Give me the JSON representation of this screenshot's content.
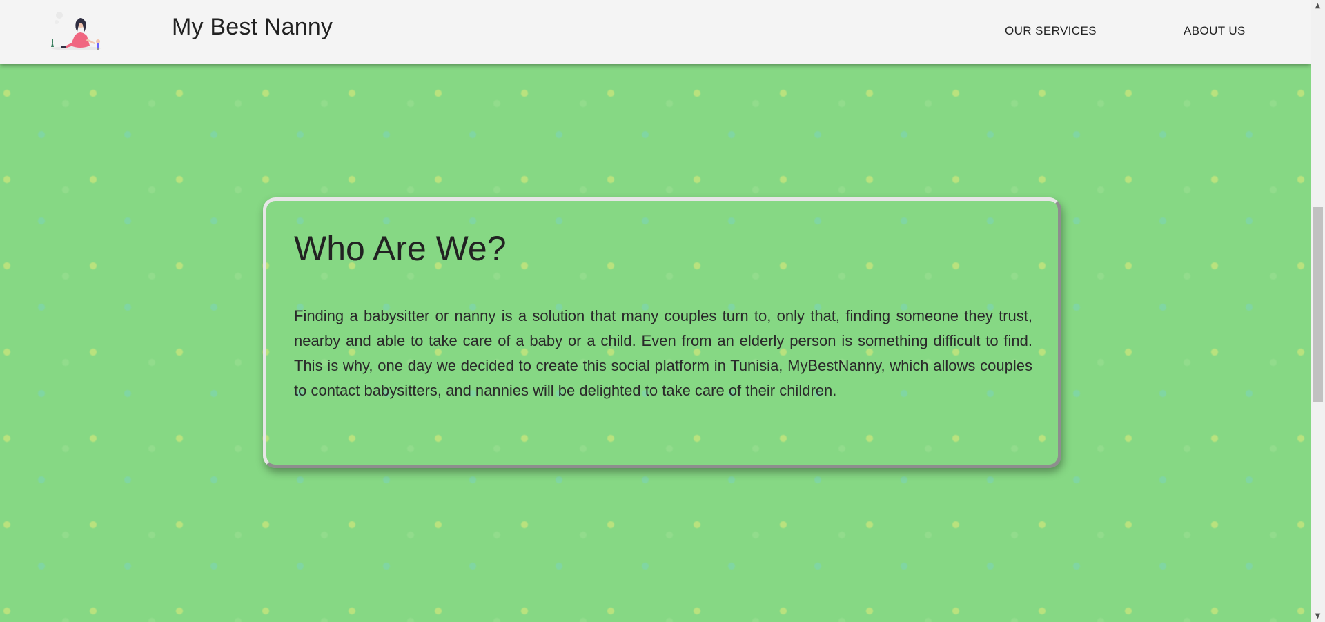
{
  "header": {
    "brand": "My Best Nanny",
    "logo_icon": "nanny-with-child-illustration",
    "nav": [
      {
        "label": "OUR SERVICES"
      },
      {
        "label": "ABOUT US"
      }
    ]
  },
  "about": {
    "title": "Who Are We?",
    "body": "Finding a babysitter or nanny is a solution that many couples turn to, only that, finding someone they trust, nearby and able to take care of a baby or a child. Even from an elderly person is something difficult to find. This is why, one day we decided to create this social platform in Tunisia, MyBestNanny, which allows couples to contact babysitters, and nannies will be delighted to take care of their children."
  },
  "colors": {
    "background": "#86d884",
    "header": "#f4f4f4",
    "text": "#222222"
  },
  "scrollbar": {
    "up_icon": "arrow-up-icon",
    "down_icon": "arrow-down-icon"
  }
}
